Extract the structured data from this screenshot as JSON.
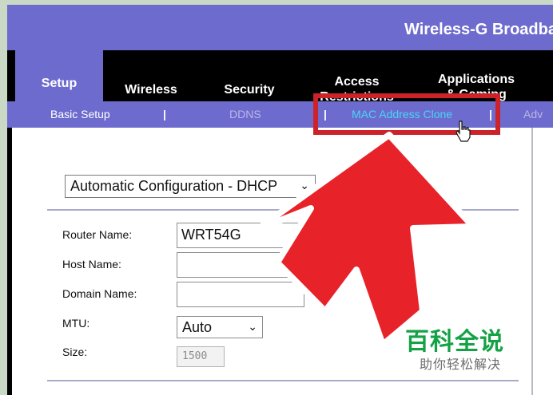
{
  "banner": {
    "title": "Wireless-G Broadba"
  },
  "nav": {
    "items": [
      {
        "label": "Setup",
        "active": true
      },
      {
        "label": "Wireless"
      },
      {
        "label": "Security"
      },
      {
        "label_line1": "Access",
        "label_line2": "Restrictions"
      },
      {
        "label_line1": "Applications",
        "label_line2": "& Gaming"
      }
    ]
  },
  "subnav": {
    "items": [
      {
        "label": "Basic Setup"
      },
      {
        "label": "DDNS"
      },
      {
        "label": "MAC Address Clone",
        "highlighted": true
      },
      {
        "label": "Adv"
      }
    ],
    "separator": "|"
  },
  "connection": {
    "selected": "Automatic Configuration - DHCP"
  },
  "form": {
    "router_name_label": "Router Name:",
    "router_name_value": "WRT54G",
    "host_name_label": "Host Name:",
    "host_name_value": "",
    "domain_name_label": "Domain Name:",
    "domain_name_value": "",
    "mtu_label": "MTU:",
    "mtu_value": "Auto",
    "size_label": "Size:",
    "size_value": "1500"
  },
  "watermark": {
    "main": "百科全说",
    "sub": "助你轻松解决"
  },
  "colors": {
    "banner": "#6e6bcf",
    "nav": "#000000",
    "highlight": "#cc2229",
    "subnav_active_text": "#45d7f5",
    "watermark": "#15a246"
  },
  "icons": {
    "chevron": "chevron-down-icon",
    "cursor": "hand-cursor-icon",
    "arrow": "red-arrow-icon"
  }
}
